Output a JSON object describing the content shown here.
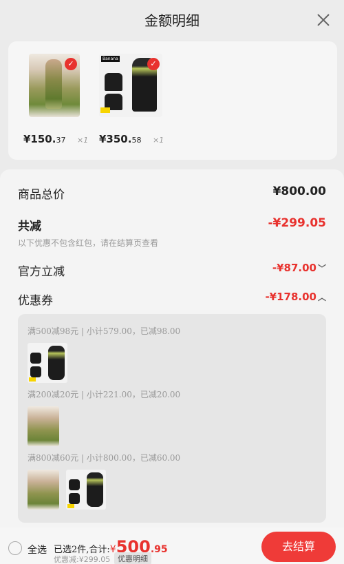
{
  "header": {
    "title": "金额明细",
    "close_icon": "close-icon"
  },
  "products": [
    {
      "price_main": "¥150.",
      "price_cents": "37",
      "qty": "×1"
    },
    {
      "price_main": "¥350.",
      "price_cents": "58",
      "qty": "×1",
      "thumb_label": "Banana"
    }
  ],
  "summary": {
    "total_label": "商品总价",
    "total_value": "¥800.00",
    "discount_label": "共减",
    "discount_value": "-¥299.05",
    "note": "以下优惠不包含红包，请在结算页查看",
    "official_label": "官方立减",
    "official_value": "-¥87.00",
    "coupon_label": "优惠券",
    "coupon_value": "-¥178.00"
  },
  "coupon_groups": [
    {
      "title": "满500减98元 | 小计579.00，已减98.00"
    },
    {
      "title": "满200减20元 | 小计221.00，已减20.00"
    },
    {
      "title": "满800减60元 | 小计800.00，已减60.00"
    }
  ],
  "bottom": {
    "select_all": "全选",
    "selected_text": "已选2件,合计:",
    "currency": "¥",
    "amount_main": "500",
    "amount_cents": ".95",
    "discount_text": "优惠减:¥299.05",
    "detail_chip": "优惠明细",
    "checkout": "去结算"
  },
  "colors": {
    "accent": "#e8322e",
    "checkout_bg": "#ef3b38"
  }
}
